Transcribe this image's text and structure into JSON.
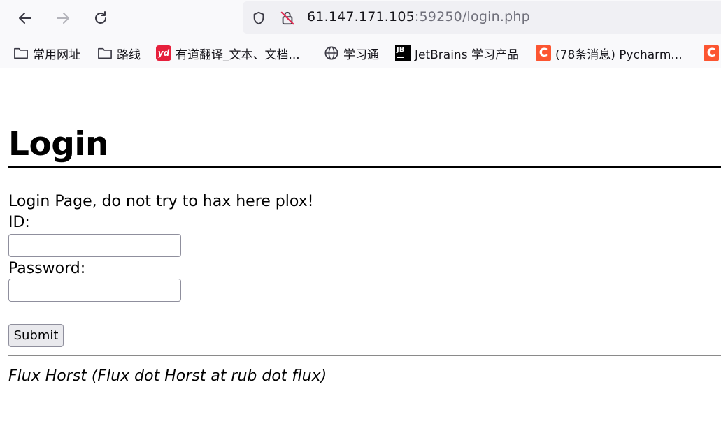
{
  "browser": {
    "url_host": "61.147.171.105",
    "url_rest": ":59250/login.php",
    "icons": {
      "back": "back-arrow-icon",
      "forward": "forward-arrow-icon",
      "reload": "reload-icon",
      "tracking": "shield-icon",
      "insecure": "insecure-lock-icon"
    },
    "bookmarks": [
      {
        "label": "常用网址",
        "icon": "folder-icon"
      },
      {
        "label": "路线",
        "icon": "folder-icon"
      },
      {
        "label": "有道翻译_文本、文档...",
        "icon": "youdao-logo-icon",
        "icon_text": "yd",
        "color": "#e6203c"
      },
      {
        "label": "学习通",
        "icon": "globe-icon"
      },
      {
        "label": "JetBrains 学习产品",
        "icon": "jetbrains-logo-icon",
        "icon_text": "JB",
        "color": "#000000"
      },
      {
        "label": "(78条消息) Pycharm...",
        "icon": "csdn-logo-icon",
        "icon_text": "C",
        "color": "#fc5531"
      },
      {
        "label": "",
        "icon": "csdn-logo-icon",
        "icon_text": "C",
        "color": "#fc5531"
      }
    ]
  },
  "page": {
    "title": "Login",
    "intro": "Login Page, do not try to hax here plox!",
    "id_label": "ID:",
    "id_value": "",
    "password_label": "Password:",
    "password_value": "",
    "submit_label": "Submit",
    "footer": "Flux Horst (Flux dot Horst at rub dot flux)"
  }
}
